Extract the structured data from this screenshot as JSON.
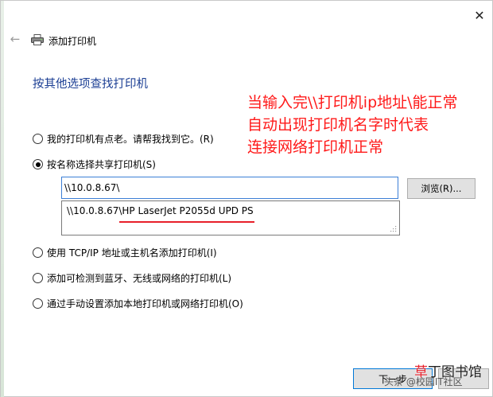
{
  "window": {
    "title": "添加打印机",
    "close_glyph": "✕",
    "back_glyph": "←"
  },
  "heading": "按其他选项查找打印机",
  "annotation": {
    "lines": [
      "当输入完\\\\打印机ip地址\\能正常",
      "自动出现打印机名字时代表",
      "连接网络打印机正常"
    ],
    "color": "#ff1a1a"
  },
  "options": {
    "old_printer": "我的打印机有点老。请帮我找到它。(R)",
    "shared_by_name": "按名称选择共享打印机(S)",
    "tcpip": "使用 TCP/IP 地址或主机名添加打印机(I)",
    "bluetooth": "添加可检测到蓝牙、无线或网络的打印机(L)",
    "manual": "通过手动设置添加本地打印机或网络打印机(O)",
    "selected": "shared_by_name"
  },
  "share_input": {
    "value": "\\\\10.0.8.67\\"
  },
  "browse_label": "浏览(R)...",
  "suggestion": {
    "prefix": "\\\\10.0.8.67\\",
    "printer_name": "HP LaserJet P2055d UPD PS",
    "underline_color": "#e8202a"
  },
  "buttons": {
    "next_label": "下一步"
  },
  "watermark": {
    "credit": "头条 @校园IT社区",
    "site_red": "草",
    "site_rest": "丁图书馆"
  },
  "icons": {
    "back": "back-arrow-icon",
    "printer": "printer-icon",
    "close": "close-icon",
    "grip": "resize-grip-icon"
  }
}
